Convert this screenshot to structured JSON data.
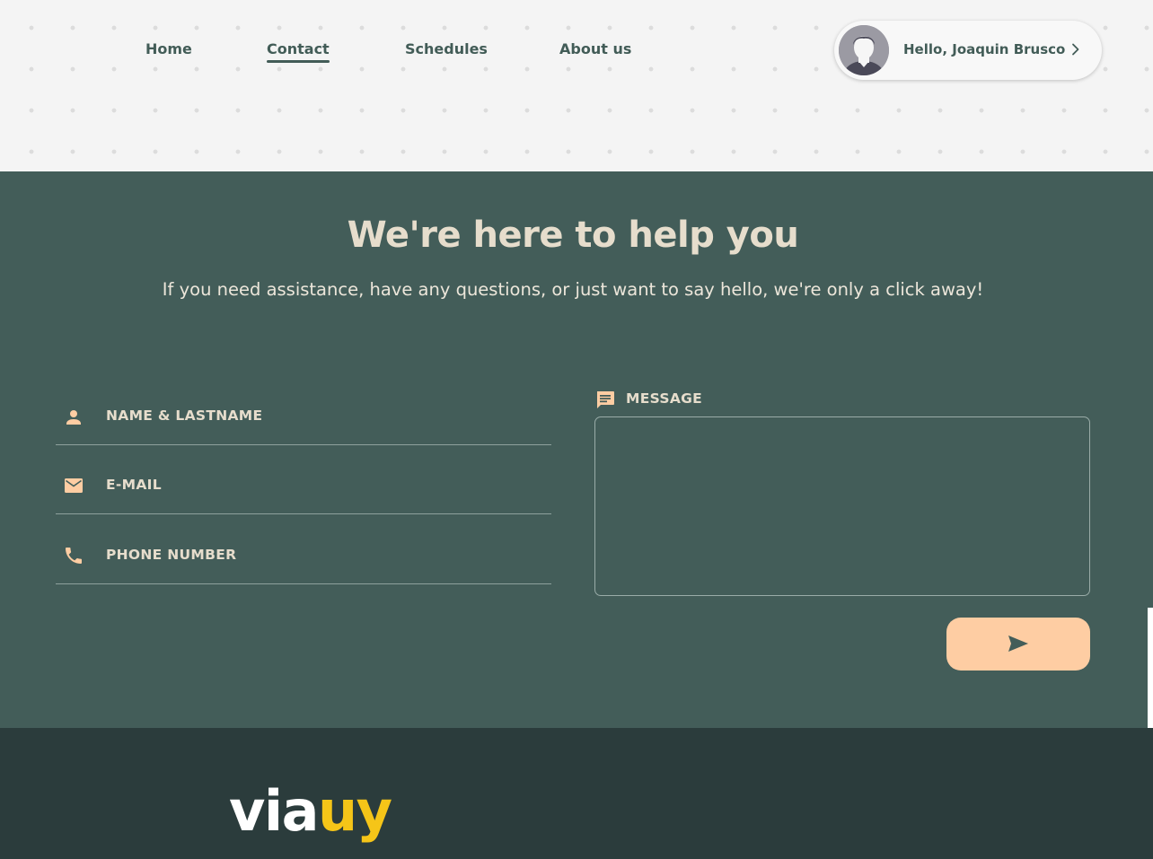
{
  "nav": {
    "items": [
      {
        "label": "Home"
      },
      {
        "label": "Contact",
        "active": true
      },
      {
        "label": "Schedules"
      },
      {
        "label": "About us"
      }
    ]
  },
  "user": {
    "greeting": "Hello, Joaquin Brusco"
  },
  "contact": {
    "title": "We're here to help you",
    "subtitle": "If you need assistance, have any questions, or just want to say hello, we're only a click away!",
    "fields": {
      "name": {
        "label": "NAME & LASTNAME",
        "value": ""
      },
      "email": {
        "label": "E-MAIL",
        "value": ""
      },
      "phone": {
        "label": "PHONE NUMBER",
        "value": ""
      }
    },
    "message": {
      "label": "MESSAGE",
      "value": ""
    }
  },
  "footer": {
    "logo_part1": "via",
    "logo_part2": "uy"
  },
  "colors": {
    "primary": "#435d59",
    "accent": "#fecda3",
    "footer_bg": "#2b3c3c",
    "logo_yellow": "#f5c518",
    "heading_text": "#e6ddcc"
  },
  "icons": {
    "name": "person-icon",
    "email": "mail-icon",
    "phone": "phone-icon",
    "message": "chat-message-icon",
    "send": "send-icon",
    "user_chevron": "chevron-right-icon"
  }
}
